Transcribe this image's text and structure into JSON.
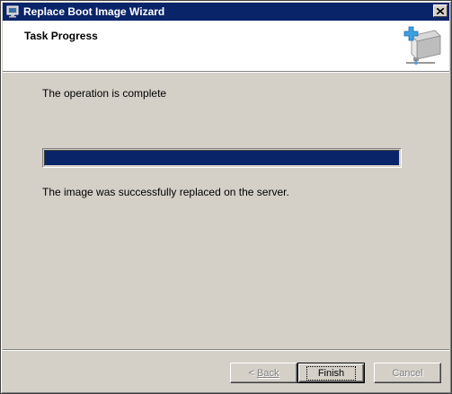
{
  "window": {
    "title": "Replace Boot Image Wizard",
    "title_icon": "wizard-monitor-icon",
    "close_icon": "close-icon"
  },
  "header": {
    "title": "Task Progress",
    "icon": "server-add-icon"
  },
  "main": {
    "status": "The operation is complete",
    "progress_fraction": 1.0,
    "progress_color": "#0a246a",
    "result": "The image was successfully replaced on the server."
  },
  "buttons": {
    "back_prefix": "< ",
    "back_label": "Back",
    "finish_label": "Finish",
    "cancel_label": "Cancel"
  }
}
